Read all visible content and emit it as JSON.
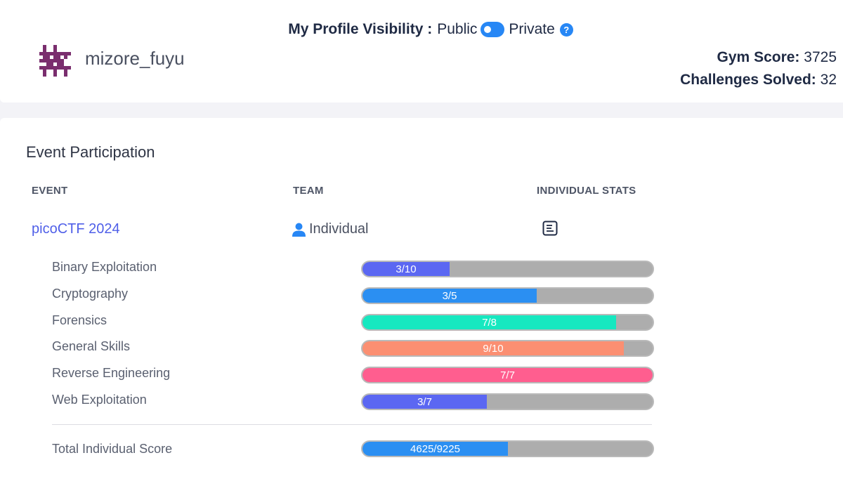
{
  "profile": {
    "username": "mizore_fuyu",
    "avatar_color": "#7a2e6e"
  },
  "visibility": {
    "label": "My Profile Visibility :",
    "public_label": "Public",
    "private_label": "Private",
    "help_glyph": "?",
    "toggle_state": "public",
    "accent": "#2787f5"
  },
  "stats": {
    "gym_score_label": "Gym Score:",
    "gym_score_value": "3725",
    "challenges_label": "Challenges Solved:",
    "challenges_value": "32"
  },
  "events": {
    "title": "Event Participation",
    "columns": {
      "event": "EVENT",
      "team": "TEAM",
      "stats": "INDIVIDUAL STATS"
    },
    "row": {
      "event_name": "picoCTF 2024",
      "team_name": "Individual",
      "team_icon": "person-icon",
      "stats_icon": "document-icon"
    },
    "categories": [
      {
        "label": "Binary Exploitation",
        "text": "3/10",
        "solved": 3,
        "total": 10,
        "color": "#5b67f2"
      },
      {
        "label": "Cryptography",
        "text": "3/5",
        "solved": 3,
        "total": 5,
        "color": "#2b8ff2"
      },
      {
        "label": "Forensics",
        "text": "7/8",
        "solved": 7,
        "total": 8,
        "color": "#16e8c0"
      },
      {
        "label": "General Skills",
        "text": "9/10",
        "solved": 9,
        "total": 10,
        "color": "#fb8f72"
      },
      {
        "label": "Reverse Engineering",
        "text": "7/7",
        "solved": 7,
        "total": 7,
        "color": "#ff5e8f"
      },
      {
        "label": "Web Exploitation",
        "text": "3/7",
        "solved": 3,
        "total": 7,
        "color": "#5b67f2"
      }
    ],
    "total": {
      "label": "Total Individual Score",
      "text": "4625/9225",
      "score": 4625,
      "max": 9225,
      "color": "#2b8ff2"
    }
  }
}
